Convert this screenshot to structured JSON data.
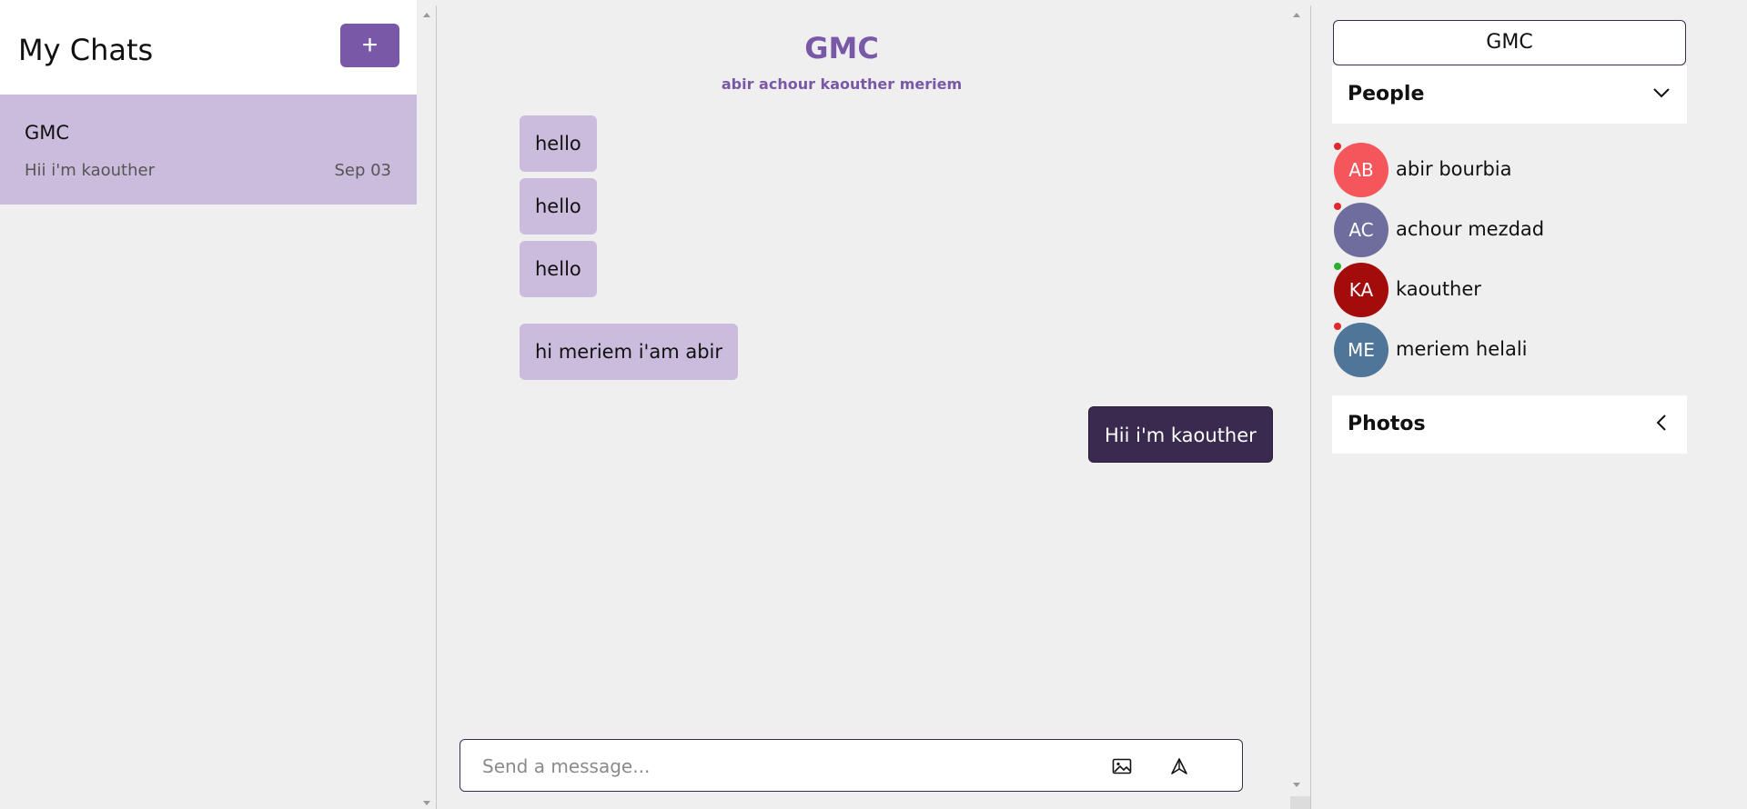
{
  "sidebar": {
    "title": "My Chats",
    "new_chat_label": "+",
    "chats": [
      {
        "name": "GMC",
        "last_message": "Hii i'm kaouther",
        "date": "Sep 03"
      }
    ]
  },
  "conversation": {
    "title": "GMC",
    "members": "abir achour kaouther meriem",
    "messages": [
      {
        "text": "hello",
        "from": "other"
      },
      {
        "text": "hello",
        "from": "other"
      },
      {
        "text": "hello",
        "from": "other"
      },
      {
        "text": "hi meriem i'am abir",
        "from": "other"
      },
      {
        "text": "Hii i'm kaouther",
        "from": "me"
      }
    ],
    "composer": {
      "placeholder": "Send a message..."
    }
  },
  "details": {
    "group_name": "GMC",
    "people_label": "People",
    "photos_label": "Photos",
    "people": [
      {
        "initials": "AB",
        "name": "abir bourbia",
        "color": "#f5565b",
        "status_color": "#e0282e"
      },
      {
        "initials": "AC",
        "name": "achour mezdad",
        "color": "#6f6d9e",
        "status_color": "#e0282e"
      },
      {
        "initials": "KA",
        "name": "kaouther",
        "color": "#a40c0c",
        "status_color": "#2bb02b"
      },
      {
        "initials": "ME",
        "name": "meriem helali",
        "color": "#4f7599",
        "status_color": "#e0282e"
      }
    ]
  },
  "theme": {
    "accent": "#7a58a8",
    "selected_chat": "#cbbcdd",
    "my_bubble": "#3b2a4f"
  }
}
